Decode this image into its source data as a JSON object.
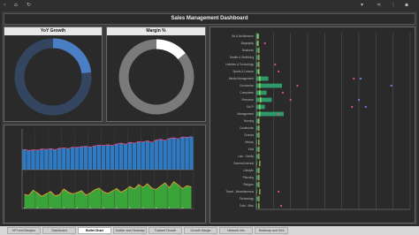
{
  "dashboard": {
    "title": "Sales Management Dashboard"
  },
  "yoy": {
    "title": "YoY Growth",
    "fraction": 0.23,
    "color": "#4a7fc6",
    "track": "#34465f"
  },
  "margin": {
    "title": "Margin %",
    "fraction": 0.14,
    "color": "#ffffff",
    "track": "#7a7a7a"
  },
  "topbar": {
    "icons": [
      "back-icon",
      "home-icon",
      "refresh-icon",
      "dropdown-icon",
      "share-icon",
      "more-icon"
    ]
  },
  "tabs": [
    {
      "label": "KPI and Margins",
      "active": false
    },
    {
      "label": "Dashboard",
      "active": false
    },
    {
      "label": "Bullet Chart",
      "active": true
    },
    {
      "label": "Scatter and Heatmap",
      "active": false
    },
    {
      "label": "Tracked Growth",
      "active": false
    },
    {
      "label": "Growth Margin",
      "active": false
    },
    {
      "label": "Network Info",
      "active": false
    },
    {
      "label": "Heatmap and Grid",
      "active": false
    }
  ],
  "chart_data": [
    {
      "type": "bar",
      "panel": "top-left-timeseries",
      "ylim": [
        0,
        10
      ],
      "values": [
        5.2,
        4.9,
        5.1,
        5.0,
        5.3,
        5.2,
        5.4,
        5.1,
        5.5,
        5.6,
        5.4,
        5.8,
        5.7,
        5.9,
        6.0,
        5.8,
        6.1,
        6.3,
        6.2,
        6.4,
        6.2,
        6.6,
        6.8,
        6.5,
        7.0,
        6.8,
        7.2,
        7.1,
        7.4,
        7.0,
        7.6,
        7.8,
        7.5,
        8.0,
        8.2,
        7.9,
        8.4,
        8.3,
        8.5
      ],
      "bar_color": "#2f7bc3",
      "line_color": "#e0508a"
    },
    {
      "type": "area",
      "panel": "bottom-left-timeseries",
      "ylim": [
        0,
        10
      ],
      "values": [
        3.5,
        3.2,
        4.5,
        3.8,
        3.0,
        3.6,
        4.2,
        3.1,
        3.4,
        4.8,
        4.0,
        3.6,
        3.9,
        4.4,
        3.3,
        3.8,
        4.6,
        5.0,
        4.1,
        3.7,
        4.3,
        4.9,
        4.0,
        4.6,
        5.4,
        4.8,
        5.9,
        5.2,
        6.1,
        5.0,
        4.7,
        5.5,
        6.3,
        5.1,
        6.6,
        5.8,
        4.9,
        5.6,
        5.3
      ],
      "fill_color": "#3aa33a",
      "line_color": "#e8a030"
    },
    {
      "type": "bar",
      "panel": "bullet-chart",
      "orientation": "horizontal",
      "categories": [
        "Art & Architecture",
        "Biography",
        "Business",
        "Health & Wellbeing",
        "Hobbies & Technology",
        "Sports & Leisure",
        "Media Management",
        "Economics",
        "Computers",
        "Romance",
        "Sci-Fi",
        "Management",
        "Nursing",
        "Cookbooks",
        "Cinema",
        "History",
        "Kids",
        "Law - Family",
        "General Interest",
        "Lifestyle",
        "Planning",
        "Religion",
        "Travel - Miscellaneous",
        "Technology",
        "Total - Misc"
      ],
      "values": [
        3,
        2,
        2,
        2,
        2,
        3,
        14,
        30,
        12,
        18,
        10,
        32,
        3,
        2,
        2,
        1,
        2,
        2,
        1,
        2,
        2,
        2,
        1,
        2,
        1
      ],
      "targets": [
        2,
        2,
        3,
        3,
        3,
        3,
        4,
        4,
        4,
        5,
        4,
        4,
        3,
        3,
        3,
        3,
        3,
        3,
        4,
        3,
        3,
        3,
        4,
        3,
        3
      ],
      "dots": [
        null,
        10,
        null,
        null,
        22,
        26,
        114,
        48,
        31,
        40,
        112,
        26,
        null,
        null,
        null,
        null,
        null,
        null,
        null,
        null,
        null,
        null,
        26,
        null,
        29
      ],
      "dots2": [
        null,
        null,
        null,
        null,
        null,
        null,
        122,
        158,
        null,
        120,
        128,
        null,
        null,
        null,
        null,
        null,
        null,
        null,
        null,
        null,
        null,
        null,
        null,
        null,
        null
      ],
      "xlim": [
        0,
        180
      ],
      "bar_color": "#2e9a6a",
      "dot_color": "#e0508a",
      "dot2_color": "#6f7ff0"
    }
  ]
}
